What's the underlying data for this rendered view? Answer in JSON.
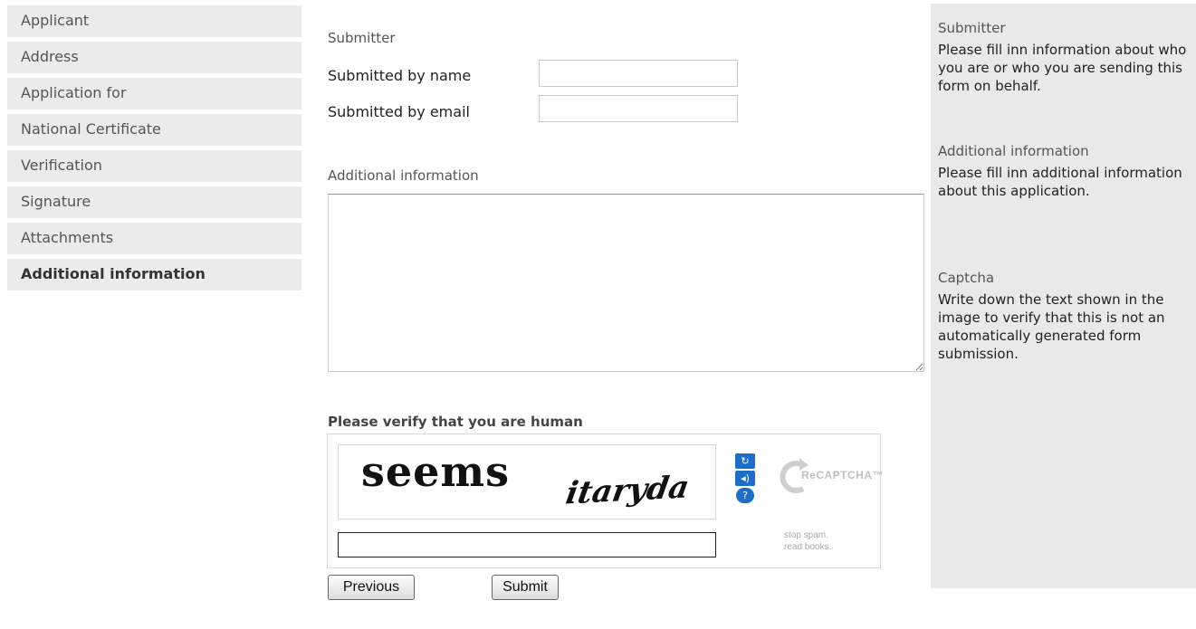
{
  "nav": {
    "items": [
      {
        "label": "Applicant",
        "active": false
      },
      {
        "label": "Address",
        "active": false
      },
      {
        "label": "Application for",
        "active": false
      },
      {
        "label": "National Certificate",
        "active": false
      },
      {
        "label": "Verification",
        "active": false
      },
      {
        "label": "Signature",
        "active": false
      },
      {
        "label": "Attachments",
        "active": false
      },
      {
        "label": "Additional information",
        "active": true
      }
    ]
  },
  "form": {
    "submitter_title": "Submitter",
    "name_label": "Submitted by name",
    "name_value": "",
    "email_label": "Submitted by email",
    "email_value": "",
    "additional_title": "Additional information",
    "additional_value": "",
    "verify_title": "Please verify that you are human",
    "captcha": {
      "word1": "seems",
      "word2": "itaryda",
      "response_value": "",
      "logo_text": "ReCAPTCHA™",
      "tagline1": "stop spam.",
      "tagline2": "read books.",
      "icons": [
        "refresh-icon",
        "audio-icon",
        "help-icon"
      ]
    },
    "previous_label": "Previous",
    "submit_label": "Submit"
  },
  "help": {
    "sections": [
      {
        "title": "Submitter",
        "text": "Please fill inn information about who you are or who you are sending this form on behalf."
      },
      {
        "title": "Additional information",
        "text": "Please fill inn additional information about this application."
      },
      {
        "title": "Captcha",
        "text": "Write down the text shown in the image to verify that this is not an automatically generated form submission."
      }
    ]
  },
  "colors": {
    "nav_bg": "#ebebeb",
    "help_bg": "#e9e9e9",
    "recaptcha_blue": "#1e6ec8"
  }
}
